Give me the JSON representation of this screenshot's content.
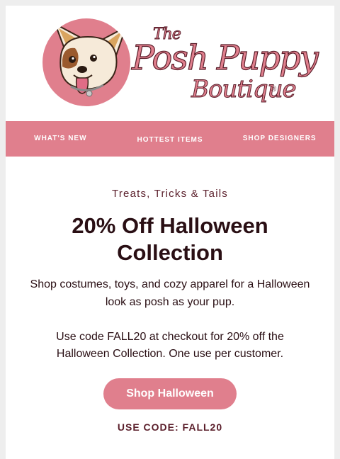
{
  "brand": {
    "wordmark_the": "The",
    "wordmark_posh": "Posh Puppy",
    "wordmark_boutique": "Boutique",
    "registered": "®",
    "colors": {
      "pink": "#e07f8d",
      "maroon": "#5a1e2a",
      "text": "#2a0f14"
    }
  },
  "nav": {
    "items": [
      {
        "label": "WHAT'S NEW"
      },
      {
        "label": "HOTTEST ITEMS"
      },
      {
        "label": "SHOP DESIGNERS"
      }
    ]
  },
  "promo": {
    "eyebrow": "Treats, Tricks & Tails",
    "headline": "20% Off Halloween Collection",
    "description": "Shop costumes, toys, and cozy apparel for a Halloween look as posh as your pup.",
    "code_note": "Use code FALL20 at checkout for 20% off the Halloween Collection. One use per customer.",
    "cta_label": "Shop Halloween",
    "use_code": "USE CODE: FALL20"
  }
}
